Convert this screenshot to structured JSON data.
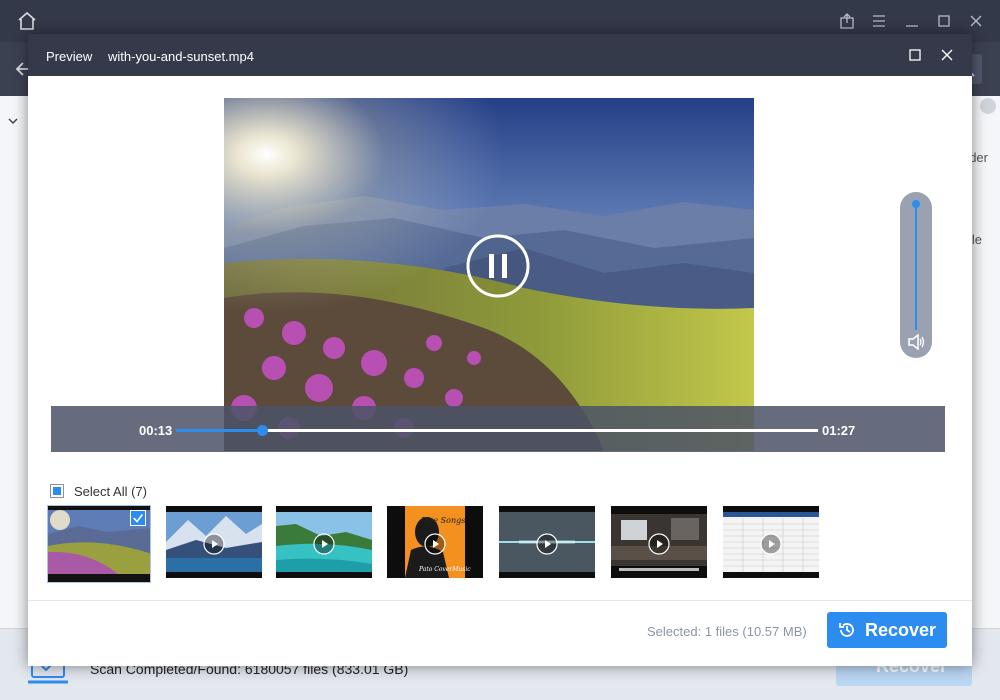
{
  "background_app": {
    "status_text": "Scan Completed/Found: 6180057 files (833.01 GB)",
    "recover_label": "Recover",
    "side_text_1": "der",
    "side_text_2": "ile"
  },
  "modal": {
    "title": "Preview",
    "filename": "with-you-and-sunset.mp4"
  },
  "player": {
    "current_time": "00:13",
    "total_time": "01:27",
    "progress": 0.134,
    "volume": 1.0,
    "state_icon": "pause-icon"
  },
  "selection": {
    "select_all_label": "Select All (7)",
    "selected_info": "Selected: 1 files (10.57 MB)"
  },
  "thumbnails": [
    {
      "name": "mountain-sunset",
      "selected": true,
      "play_icon": false
    },
    {
      "name": "lake-mountains",
      "selected": false,
      "play_icon": true
    },
    {
      "name": "turquoise-coast",
      "selected": false,
      "play_icon": true
    },
    {
      "name": "album-cover",
      "selected": false,
      "play_icon": true,
      "text_line1": "Live Songs",
      "text_line2": "Pato CoverMusic"
    },
    {
      "name": "waveform",
      "selected": false,
      "play_icon": true
    },
    {
      "name": "desk-tutorial",
      "selected": false,
      "play_icon": true
    },
    {
      "name": "spreadsheet",
      "selected": false,
      "play_icon": true
    }
  ],
  "footer": {
    "recover_label": "Recover"
  },
  "colors": {
    "accent": "#2d8cf0",
    "titlebar": "#353a4b",
    "seekbar": "#4b5266"
  }
}
